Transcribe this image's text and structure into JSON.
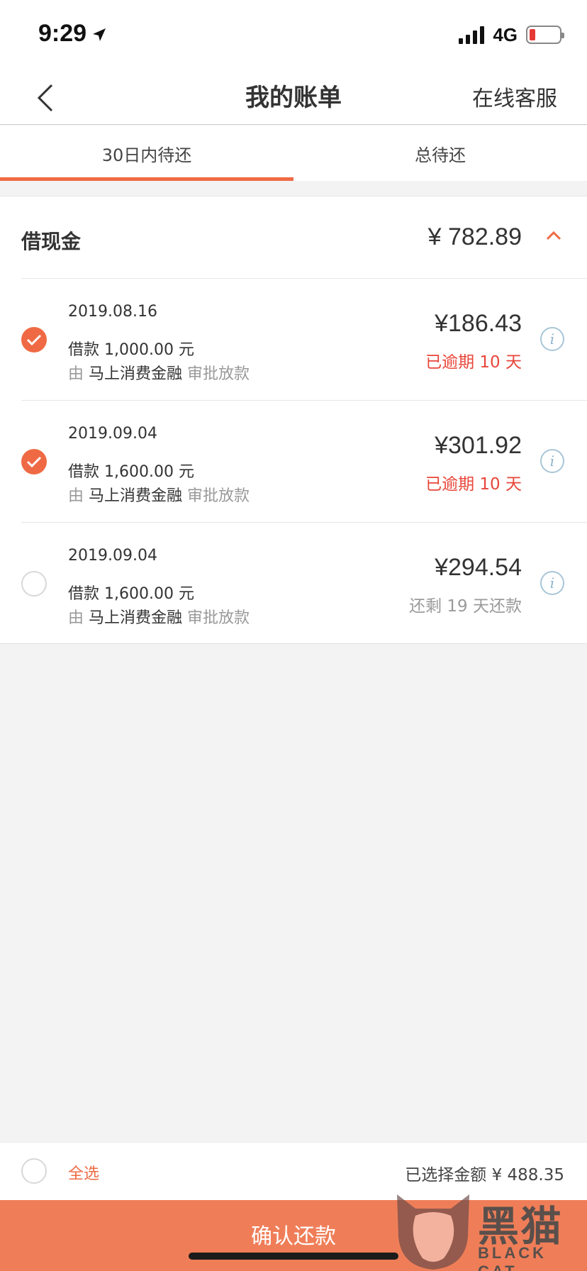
{
  "status_bar": {
    "time": "9:29",
    "network": "4G",
    "icons": [
      "location-arrow-icon",
      "signal-icon",
      "battery-icon"
    ]
  },
  "nav": {
    "title": "我的账单",
    "right_link": "在线客服",
    "back_icon": "chevron-left-icon"
  },
  "tabs": [
    {
      "label": "30日内待还",
      "active": true
    },
    {
      "label": "总待还",
      "active": false
    }
  ],
  "section": {
    "title": "借现金",
    "total": "¥ 782.89",
    "collapse_icon": "chevron-up-icon",
    "bills": [
      {
        "date": "2019.08.16",
        "loan": "借款 1,000.00 元",
        "source_prefix": "由",
        "lender": "马上消费金融",
        "source_suffix": "审批放款",
        "amount": "¥186.43",
        "status": "已逾期 10 天",
        "overdue": true,
        "checked": true
      },
      {
        "date": "2019.09.04",
        "loan": "借款 1,600.00 元",
        "source_prefix": "由",
        "lender": "马上消费金融",
        "source_suffix": "审批放款",
        "amount": "¥301.92",
        "status": "已逾期 10 天",
        "overdue": true,
        "checked": true
      },
      {
        "date": "2019.09.04",
        "loan": "借款 1,600.00 元",
        "source_prefix": "由",
        "lender": "马上消费金融",
        "source_suffix": "审批放款",
        "amount": "¥294.54",
        "status": "还剩 19 天还款",
        "overdue": false,
        "checked": false
      }
    ]
  },
  "footer": {
    "select_all": "全选",
    "selected_amount": "已选择金额 ¥ 488.35",
    "confirm": "确认还款"
  },
  "watermark": {
    "text": "黑猫",
    "sub": "BLACK CAT"
  },
  "colors": {
    "accent": "#ef6a44",
    "overdue": "#e8463a",
    "button": "#ef7e58"
  }
}
